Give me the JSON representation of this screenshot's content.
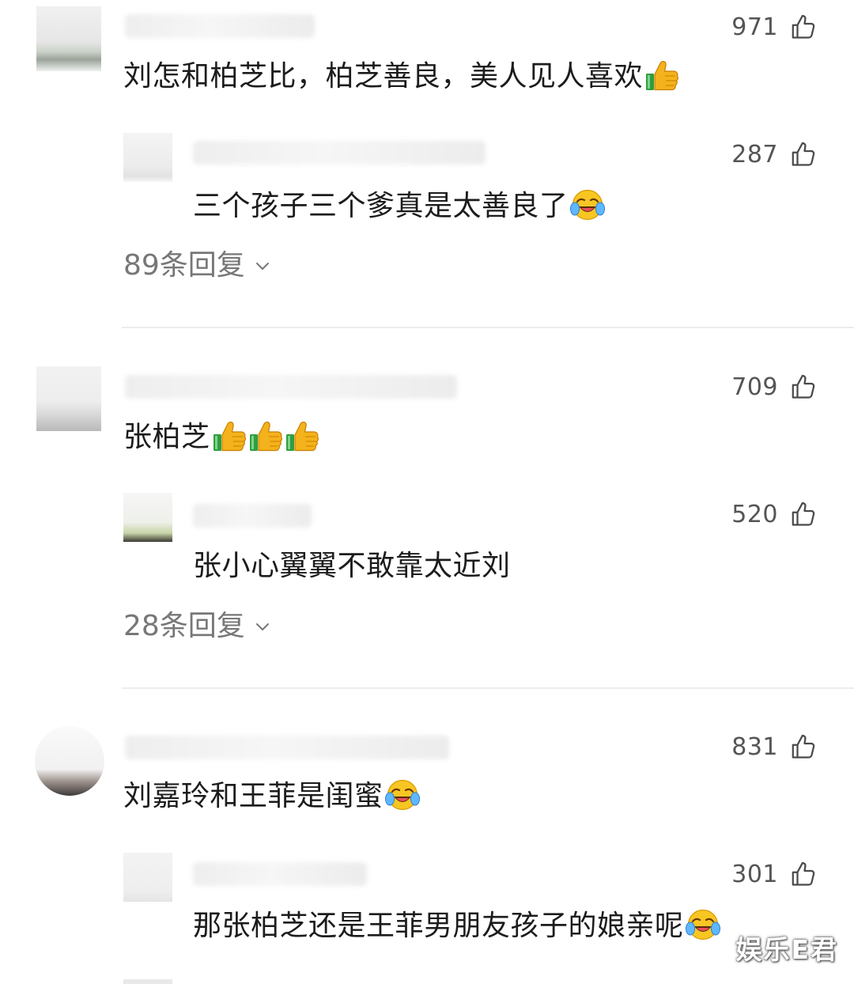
{
  "threads": [
    {
      "comment": {
        "text": "刘怎和柏芝比，柏芝善良，美人见人喜欢",
        "emoji": "thumbs-up",
        "likes": "971"
      },
      "reply": {
        "text": "三个孩子三个爹真是太善良了",
        "emoji": "laughing-crying",
        "likes": "287"
      },
      "replies_label": "89条回复"
    },
    {
      "comment": {
        "text": "张柏芝",
        "emoji": "thumbs-up-x3",
        "likes": "709"
      },
      "reply": {
        "text": "张小心翼翼不敢靠太近刘",
        "likes": "520"
      },
      "replies_label": "28条回复"
    },
    {
      "comment": {
        "text": "刘嘉玲和王菲是闺蜜",
        "emoji": "laughing-crying",
        "likes": "831"
      },
      "reply": {
        "text": "那张柏芝还是王菲男朋友孩子的娘亲呢",
        "emoji": "laughing-crying",
        "likes": "301"
      }
    }
  ],
  "watermark": "娱乐E君",
  "icons": {
    "like": "thumbs-up-outline-icon",
    "expand": "chevron-down-icon"
  },
  "colors": {
    "text": "#1c1c1c",
    "secondary": "#777777",
    "divider": "#ececec"
  }
}
